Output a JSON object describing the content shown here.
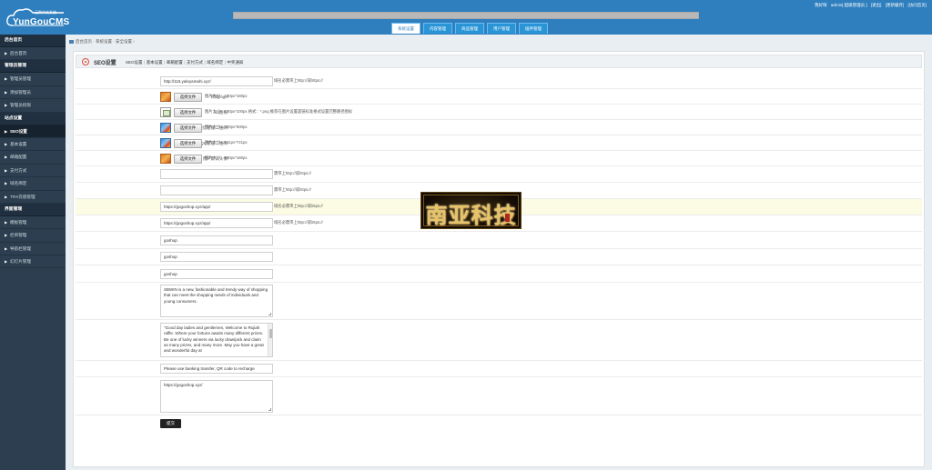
{
  "header": {
    "logo_subtitle": "云购中文系统",
    "logo_title": "YunGouCMS",
    "top_links": [
      "我好呀",
      "admin[ 超级管理员 ]",
      "[退出]",
      "[更新缓存]",
      "[访问首页]"
    ],
    "nav_tabs": [
      {
        "label": "系统设置",
        "active": true
      },
      {
        "label": "内容管理",
        "active": false
      },
      {
        "label": "商品管理",
        "active": false
      },
      {
        "label": "用户管理",
        "active": false
      },
      {
        "label": "插件管理",
        "active": false
      }
    ]
  },
  "sidebar": [
    {
      "type": "group",
      "label": "后台首页"
    },
    {
      "type": "item",
      "label": "后台首页"
    },
    {
      "type": "group",
      "label": "管理员管理"
    },
    {
      "type": "item",
      "label": "管理员管理"
    },
    {
      "type": "item",
      "label": "添加管理员"
    },
    {
      "type": "item",
      "label": "管理员权限"
    },
    {
      "type": "group",
      "label": "站点设置"
    },
    {
      "type": "item",
      "label": "SEO设置",
      "active": true
    },
    {
      "type": "item",
      "label": "基本设置"
    },
    {
      "type": "item",
      "label": "邮箱配置"
    },
    {
      "type": "item",
      "label": "支付方式"
    },
    {
      "type": "item",
      "label": "域名绑定"
    },
    {
      "type": "item",
      "label": "TRX充值管理"
    },
    {
      "type": "group",
      "label": "界面管理"
    },
    {
      "type": "item",
      "label": "模板管理"
    },
    {
      "type": "item",
      "label": "栏目管理"
    },
    {
      "type": "item",
      "label": "导航栏管理"
    },
    {
      "type": "item",
      "label": "幻灯片管理"
    }
  ],
  "breadcrumb": "后台首页 · 系统设置 · 安全设置 ›",
  "panel": {
    "title": "SEO设置",
    "tabs": [
      "SEO设置",
      "基本设置",
      "邮箱配置",
      "支付方式",
      "域名绑定",
      "中奖通知"
    ]
  },
  "form": {
    "site_url": {
      "label": "网站域名:",
      "value": "http://115.yaleyamahi.xyz/",
      "hint": "域名必需带上http://或https://"
    },
    "site_logo": {
      "label": "网站logo:",
      "button": "选择文件",
      "hint": "图片大小：180px*180px"
    },
    "ico": {
      "label": "ico图标:",
      "button": "选择文件",
      "hint": "图片大小：100px*100px  格式：*.png 推荐在图片设置超链标准格式设置完整路径图标"
    },
    "wechat_qr": {
      "label": "微信客服二维码:",
      "button": "选择文件",
      "hint": "图片大小：300px*600px"
    },
    "qq_qr": {
      "label": "QQ客服二维码:",
      "button": "选择文件",
      "hint": "图片大小：541px*741px"
    },
    "avatar": {
      "label": "用户默认头像:",
      "button": "选择文件",
      "hint": "图片大小：180px*180px"
    },
    "facebook": {
      "label": "FaceBook:",
      "value": "",
      "hint": "需带上http://或https://"
    },
    "line": {
      "label": "Line:",
      "value": "",
      "hint": "需带上http://或https://"
    },
    "ios_download": {
      "label": "IOS下载地址:",
      "value": "https://gogoshop.xyz/app/",
      "hint": "域名必需带上http://或https://"
    },
    "android_download": {
      "label": "Android下载地址:",
      "value": "https://gogoshop.xyz/app/",
      "hint": "域名必需带上http://或https://"
    },
    "site_name": {
      "label": "网站名称:",
      "value": "goshop"
    },
    "site_title": {
      "label": "网站标题:",
      "value": "goshop"
    },
    "site_keywords": {
      "label": "网站关键字:",
      "value": "goshop"
    },
    "site_description": {
      "label": "网站描述:",
      "value": "SBWIN is a new, fashionable and trendy way of shopping that can meet the shopping needs of individuals and young consumers."
    },
    "lucky_announcement": {
      "label": "首页滚动公告:",
      "value": "\"Good day ladies and gentlemen, Welcome to Rujiah raffle. Where your fortune awaits many different prizes. Be one of lucky winners via lucky draw/pick and claim as many prizes, and many more. May you have a great and wonderful day at"
    },
    "recharge_notice": {
      "label": "线下充值提示:",
      "value": "Please use banking transfer, QR code to recharge"
    },
    "service_link": {
      "label": "客服链接:",
      "value": "https://gogoshop.xyz/"
    },
    "submit": "提交"
  },
  "watermark": "南亚科技",
  "colors": {
    "header": "#2f7fbe",
    "sidebar": "#2c3e4f",
    "highlight_row": "#fbfce3",
    "watermark_gold": "#e6c36a"
  }
}
